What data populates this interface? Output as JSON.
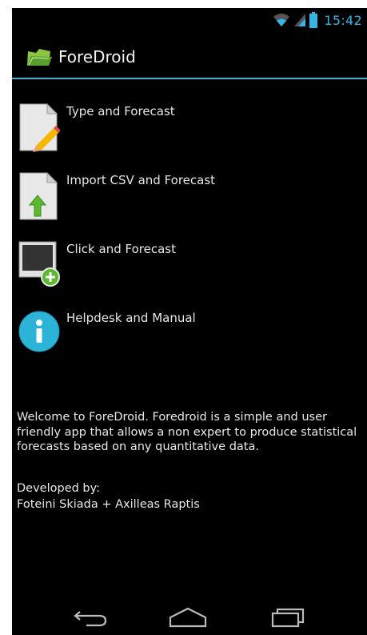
{
  "status_bar": {
    "time": "15:42",
    "icons": [
      "wifi-icon",
      "signal-icon",
      "battery-icon"
    ],
    "accent_color": "#33b5e5"
  },
  "action_bar": {
    "title": "ForeDroid",
    "icon": "app-logo-icon"
  },
  "menu": {
    "items": [
      {
        "label": "Type and Forecast",
        "icon": "document-pencil-icon"
      },
      {
        "label": "Import CSV and Forecast",
        "icon": "document-import-icon"
      },
      {
        "label": "Click and Forecast",
        "icon": "screen-add-icon"
      },
      {
        "label": "Helpdesk and Manual",
        "icon": "info-icon"
      }
    ]
  },
  "footer": {
    "welcome": "Welcome to ForeDroid. Foredroid is a simple and user friendly app that allows a non expert to produce statistical forecasts based on any quantitative data.",
    "developed_by_label": "Developed by:",
    "developers": "Foteini Skiada + Axilleas Raptis"
  },
  "nav_bar": {
    "buttons": [
      "back-icon",
      "home-icon",
      "recent-apps-icon"
    ]
  }
}
